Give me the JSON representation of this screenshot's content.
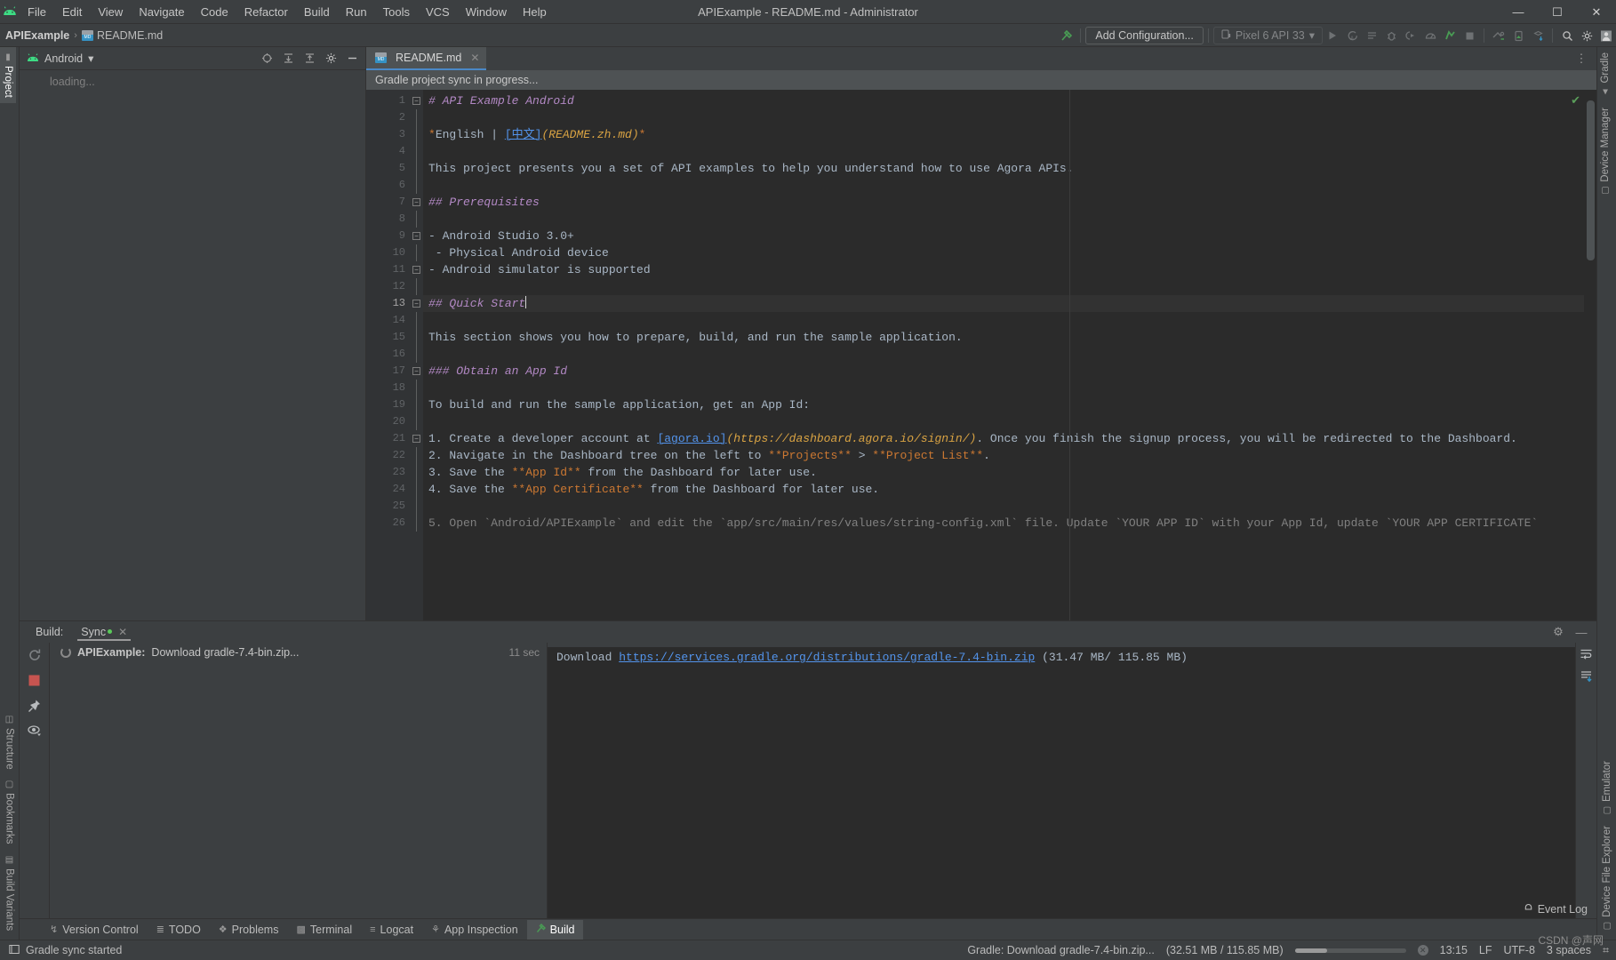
{
  "window": {
    "title": "APIExample - README.md - Administrator",
    "logo_icon": "android-logo-icon",
    "minimize_label": "—",
    "maximize_label": "☐",
    "close_label": "✕"
  },
  "menu": {
    "items": [
      "File",
      "Edit",
      "View",
      "Navigate",
      "Code",
      "Refactor",
      "Build",
      "Run",
      "Tools",
      "VCS",
      "Window",
      "Help"
    ]
  },
  "navbar": {
    "breadcrumb": {
      "project": "APIExample",
      "separator": "›",
      "file": "README.md",
      "file_icon": "markdown-file-icon"
    },
    "add_configuration": "Add Configuration...",
    "device_selector": "Pixel 6 API 33",
    "device_icon": "device-icon",
    "chevron": "▾",
    "hammer_icon": "build-hammer-icon",
    "buttons": [
      {
        "name": "run-button",
        "glyph": "▶"
      },
      {
        "name": "run-tests-button",
        "glyph": "Ⓐ"
      },
      {
        "name": "apply-changes-button",
        "glyph": "☰"
      },
      {
        "name": "debug-button",
        "glyph": "✶"
      },
      {
        "name": "attach-debugger-button",
        "glyph": "◑"
      },
      {
        "name": "profiler-button",
        "glyph": "◔"
      },
      {
        "name": "sync-gradle-button",
        "glyph": "↻"
      },
      {
        "name": "stop-button",
        "glyph": "■"
      }
    ],
    "right_buttons": [
      {
        "name": "avd-manager-button",
        "glyph": "▣"
      },
      {
        "name": "sdk-manager-button",
        "glyph": "⬇"
      },
      {
        "name": "search-everywhere-icon",
        "glyph": "⚲"
      },
      {
        "name": "settings-gear-icon",
        "glyph": "⚙"
      },
      {
        "name": "account-avatar",
        "glyph": "■"
      }
    ]
  },
  "left_tool_bar": {
    "items": [
      {
        "label": "Project",
        "icon": "folder-icon",
        "active": true
      },
      {
        "label": "Structure",
        "icon": "structure-icon",
        "active": false
      },
      {
        "label": "Bookmarks",
        "icon": "bookmark-icon",
        "active": false
      },
      {
        "label": "Build Variants",
        "icon": "variants-icon",
        "active": false
      }
    ]
  },
  "right_tool_bar": {
    "top_items": [
      {
        "label": "Gradle",
        "icon": "gradle-elephant-icon"
      },
      {
        "label": "Device Manager",
        "icon": "device-manager-icon"
      }
    ],
    "bottom_items": [
      {
        "label": "Emulator",
        "icon": "emulator-icon"
      },
      {
        "label": "Device File Explorer",
        "icon": "device-file-icon"
      }
    ]
  },
  "project_pane": {
    "title": "Android",
    "title_icon": "android-head-icon",
    "chevron": "▾",
    "actions": [
      {
        "name": "select-opened-file-button",
        "glyph": "⊕"
      },
      {
        "name": "expand-all-button",
        "glyph": "⤓"
      },
      {
        "name": "collapse-all-button",
        "glyph": "⤒"
      },
      {
        "name": "pane-settings-button",
        "glyph": "⚙"
      },
      {
        "name": "hide-pane-button",
        "glyph": "—"
      }
    ],
    "loading_text": "loading..."
  },
  "editor": {
    "tab": {
      "label": "README.md",
      "icon": "markdown-file-icon",
      "close": "✕"
    },
    "tab_options_icon": "⋮",
    "banner": "Gradle project sync in progress...",
    "inspection_ok_glyph": "✔",
    "current_line": 13,
    "lines": [
      {
        "n": 1,
        "fold": "open",
        "segments": [
          {
            "t": "# API Example Android",
            "c": "t-h"
          }
        ]
      },
      {
        "n": 2,
        "fold": "bar",
        "segments": []
      },
      {
        "n": 3,
        "fold": "bar",
        "segments": [
          {
            "t": "*",
            "c": "t-em"
          },
          {
            "t": "English | ",
            "c": "t-txt"
          },
          {
            "t": "[中文]",
            "c": "t-link"
          },
          {
            "t": "(README.zh.md)",
            "c": "t-url"
          },
          {
            "t": "*",
            "c": "t-em"
          }
        ]
      },
      {
        "n": 4,
        "fold": "bar",
        "segments": []
      },
      {
        "n": 5,
        "fold": "bar",
        "segments": [
          {
            "t": "This project presents you a set of API examples to help you understand how to use Agora APIs.",
            "c": "t-txt"
          }
        ]
      },
      {
        "n": 6,
        "fold": "bar",
        "segments": []
      },
      {
        "n": 7,
        "fold": "open",
        "segments": [
          {
            "t": "## Prerequisites",
            "c": "t-h"
          }
        ]
      },
      {
        "n": 8,
        "fold": "bar",
        "segments": []
      },
      {
        "n": 9,
        "fold": "open",
        "segments": [
          {
            "t": "- Android Studio 3.0+",
            "c": "t-txt"
          }
        ]
      },
      {
        "n": 10,
        "fold": "bar",
        "segments": [
          {
            "t": " - Physical Android device",
            "c": "t-txt"
          }
        ]
      },
      {
        "n": 11,
        "fold": "open",
        "segments": [
          {
            "t": "- Android simulator is supported",
            "c": "t-txt"
          }
        ]
      },
      {
        "n": 12,
        "fold": "bar",
        "segments": []
      },
      {
        "n": 13,
        "fold": "open",
        "segments": [
          {
            "t": "## Quick Start",
            "c": "t-h"
          }
        ],
        "caret": true
      },
      {
        "n": 14,
        "fold": "bar",
        "segments": []
      },
      {
        "n": 15,
        "fold": "bar",
        "segments": [
          {
            "t": "This section shows you how to prepare, build, and run the sample application.",
            "c": "t-txt"
          }
        ]
      },
      {
        "n": 16,
        "fold": "bar",
        "segments": []
      },
      {
        "n": 17,
        "fold": "open",
        "segments": [
          {
            "t": "### Obtain an App Id",
            "c": "t-h"
          }
        ]
      },
      {
        "n": 18,
        "fold": "bar",
        "segments": []
      },
      {
        "n": 19,
        "fold": "bar",
        "segments": [
          {
            "t": "To build and run the sample application, get an App Id:",
            "c": "t-txt"
          }
        ]
      },
      {
        "n": 20,
        "fold": "bar",
        "segments": []
      },
      {
        "n": 21,
        "fold": "open",
        "segments": [
          {
            "t": "1. Create a developer account at ",
            "c": "t-txt"
          },
          {
            "t": "[agora.io]",
            "c": "t-link"
          },
          {
            "t": "(https://dashboard.agora.io/signin/)",
            "c": "t-url"
          },
          {
            "t": ". Once you finish the signup process, you will be redirected to the Dashboard.",
            "c": "t-txt"
          }
        ]
      },
      {
        "n": 22,
        "fold": "bar",
        "segments": [
          {
            "t": "2. Navigate in the Dashboard tree on the left to ",
            "c": "t-txt"
          },
          {
            "t": "**Projects**",
            "c": "t-em"
          },
          {
            "t": " > ",
            "c": "t-txt"
          },
          {
            "t": "**Project List**",
            "c": "t-em"
          },
          {
            "t": ".",
            "c": "t-txt"
          }
        ]
      },
      {
        "n": 23,
        "fold": "bar",
        "segments": [
          {
            "t": "3. Save the ",
            "c": "t-txt"
          },
          {
            "t": "**App Id**",
            "c": "t-em"
          },
          {
            "t": " from the Dashboard for later use.",
            "c": "t-txt"
          }
        ]
      },
      {
        "n": 24,
        "fold": "bar",
        "segments": [
          {
            "t": "4. Save the ",
            "c": "t-txt"
          },
          {
            "t": "**App Certificate**",
            "c": "t-em"
          },
          {
            "t": " from the Dashboard for later use.",
            "c": "t-txt"
          }
        ]
      },
      {
        "n": 25,
        "fold": "bar",
        "segments": []
      },
      {
        "n": 26,
        "fold": "bar",
        "segments": [
          {
            "t": "5. Open `Android/APIExample` and edit the `app/src/main/res/values/string-config.xml` file. Update `YOUR APP ID` with your App Id, update `YOUR APP CERTIFICATE`",
            "c": "t-dim"
          }
        ]
      }
    ]
  },
  "build_panel": {
    "label": "Build:",
    "tab": "Sync",
    "tab_close": "✕",
    "settings_icon": "⚙",
    "hide_icon": "—",
    "tool_icons": [
      {
        "name": "rerun-sync-button",
        "glyph": "↻"
      },
      {
        "name": "stop-button",
        "glyph": "■"
      },
      {
        "name": "pin-tab-button",
        "glyph": "✐"
      },
      {
        "name": "toggle-view-button",
        "glyph": "◉"
      }
    ],
    "tree_row": {
      "bold": "APIExample:",
      "text": "Download gradle-7.4-bin.zip...",
      "time": "11 sec"
    },
    "console": {
      "prefix": "Download ",
      "url": "https://services.gradle.org/distributions/gradle-7.4-bin.zip",
      "suffix": " (31.47 MB/ 115.85 MB)"
    },
    "right_icons": [
      {
        "name": "soft-wrap-button",
        "glyph": "≡"
      },
      {
        "name": "scroll-to-end-button",
        "glyph": "↧"
      }
    ]
  },
  "bottom_tabs": {
    "items": [
      {
        "label": "Version Control",
        "icon": "branch-icon",
        "active": false
      },
      {
        "label": "TODO",
        "icon": "list-icon",
        "active": false
      },
      {
        "label": "Problems",
        "icon": "warning-icon",
        "active": false
      },
      {
        "label": "Terminal",
        "icon": "terminal-icon",
        "active": false
      },
      {
        "label": "Logcat",
        "icon": "logcat-icon",
        "active": false
      },
      {
        "label": "App Inspection",
        "icon": "inspection-icon",
        "active": false
      },
      {
        "label": "Build",
        "icon": "hammer-icon",
        "active": true
      }
    ],
    "event_log": {
      "label": "Event Log",
      "icon": "bell-icon"
    }
  },
  "statusbar": {
    "left_icon": "terminal-square-icon",
    "message": "Gradle sync started",
    "task": "Gradle: Download gradle-7.4-bin.zip...",
    "size": "(32.51 MB / 115.85 MB)",
    "cancel_glyph": "✕",
    "time": "13:15",
    "line_sep": "LF",
    "encoding": "UTF-8",
    "indent": "3 spaces",
    "lock_icon": "⌗"
  },
  "watermark": "CSDN @声网"
}
